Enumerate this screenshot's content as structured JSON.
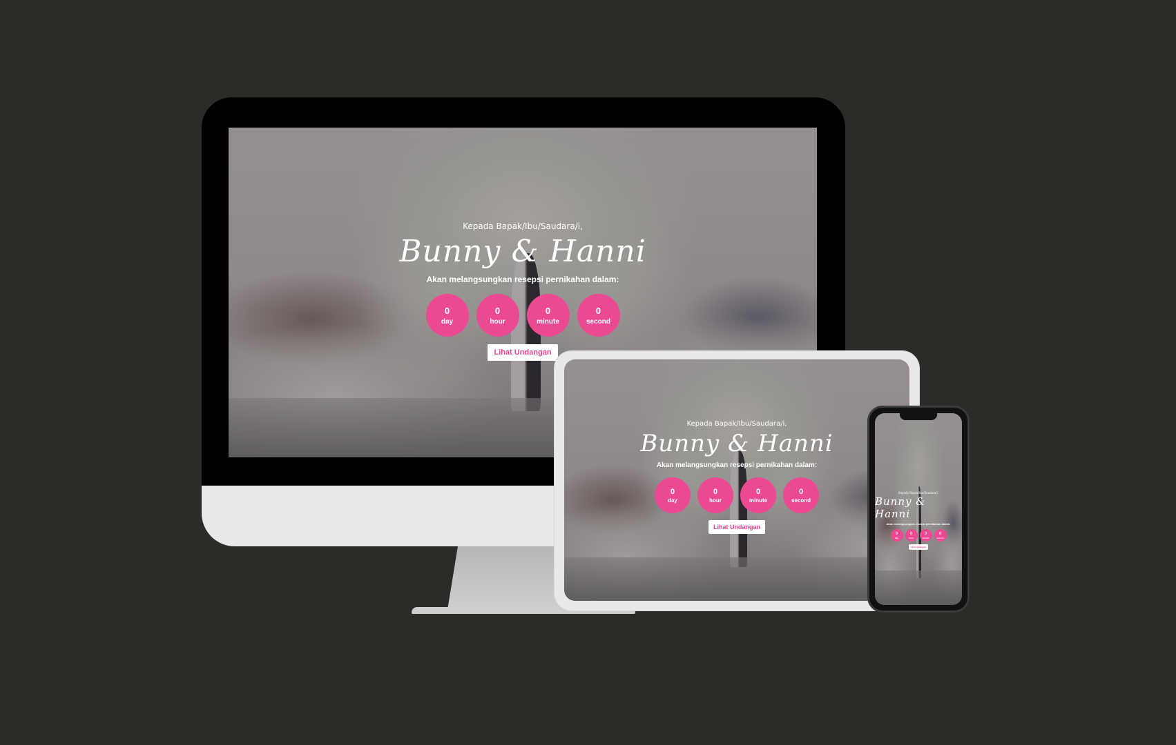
{
  "invitation": {
    "greeting": "Kepada Bapak/Ibu/Saudara/i,",
    "couple_name": "Bunny & Hanni",
    "subtitle": "Akan melangsungkan resepsi pernikahan dalam:",
    "countdown": [
      {
        "value": "0",
        "label": "day"
      },
      {
        "value": "0",
        "label": "hour"
      },
      {
        "value": "0",
        "label": "minute"
      },
      {
        "value": "0",
        "label": "second"
      }
    ],
    "cta_label": "Lihat Undangan"
  },
  "colors": {
    "page_background": "#2d2b27",
    "accent": "#eb4a93",
    "button_text": "#e9448f"
  }
}
